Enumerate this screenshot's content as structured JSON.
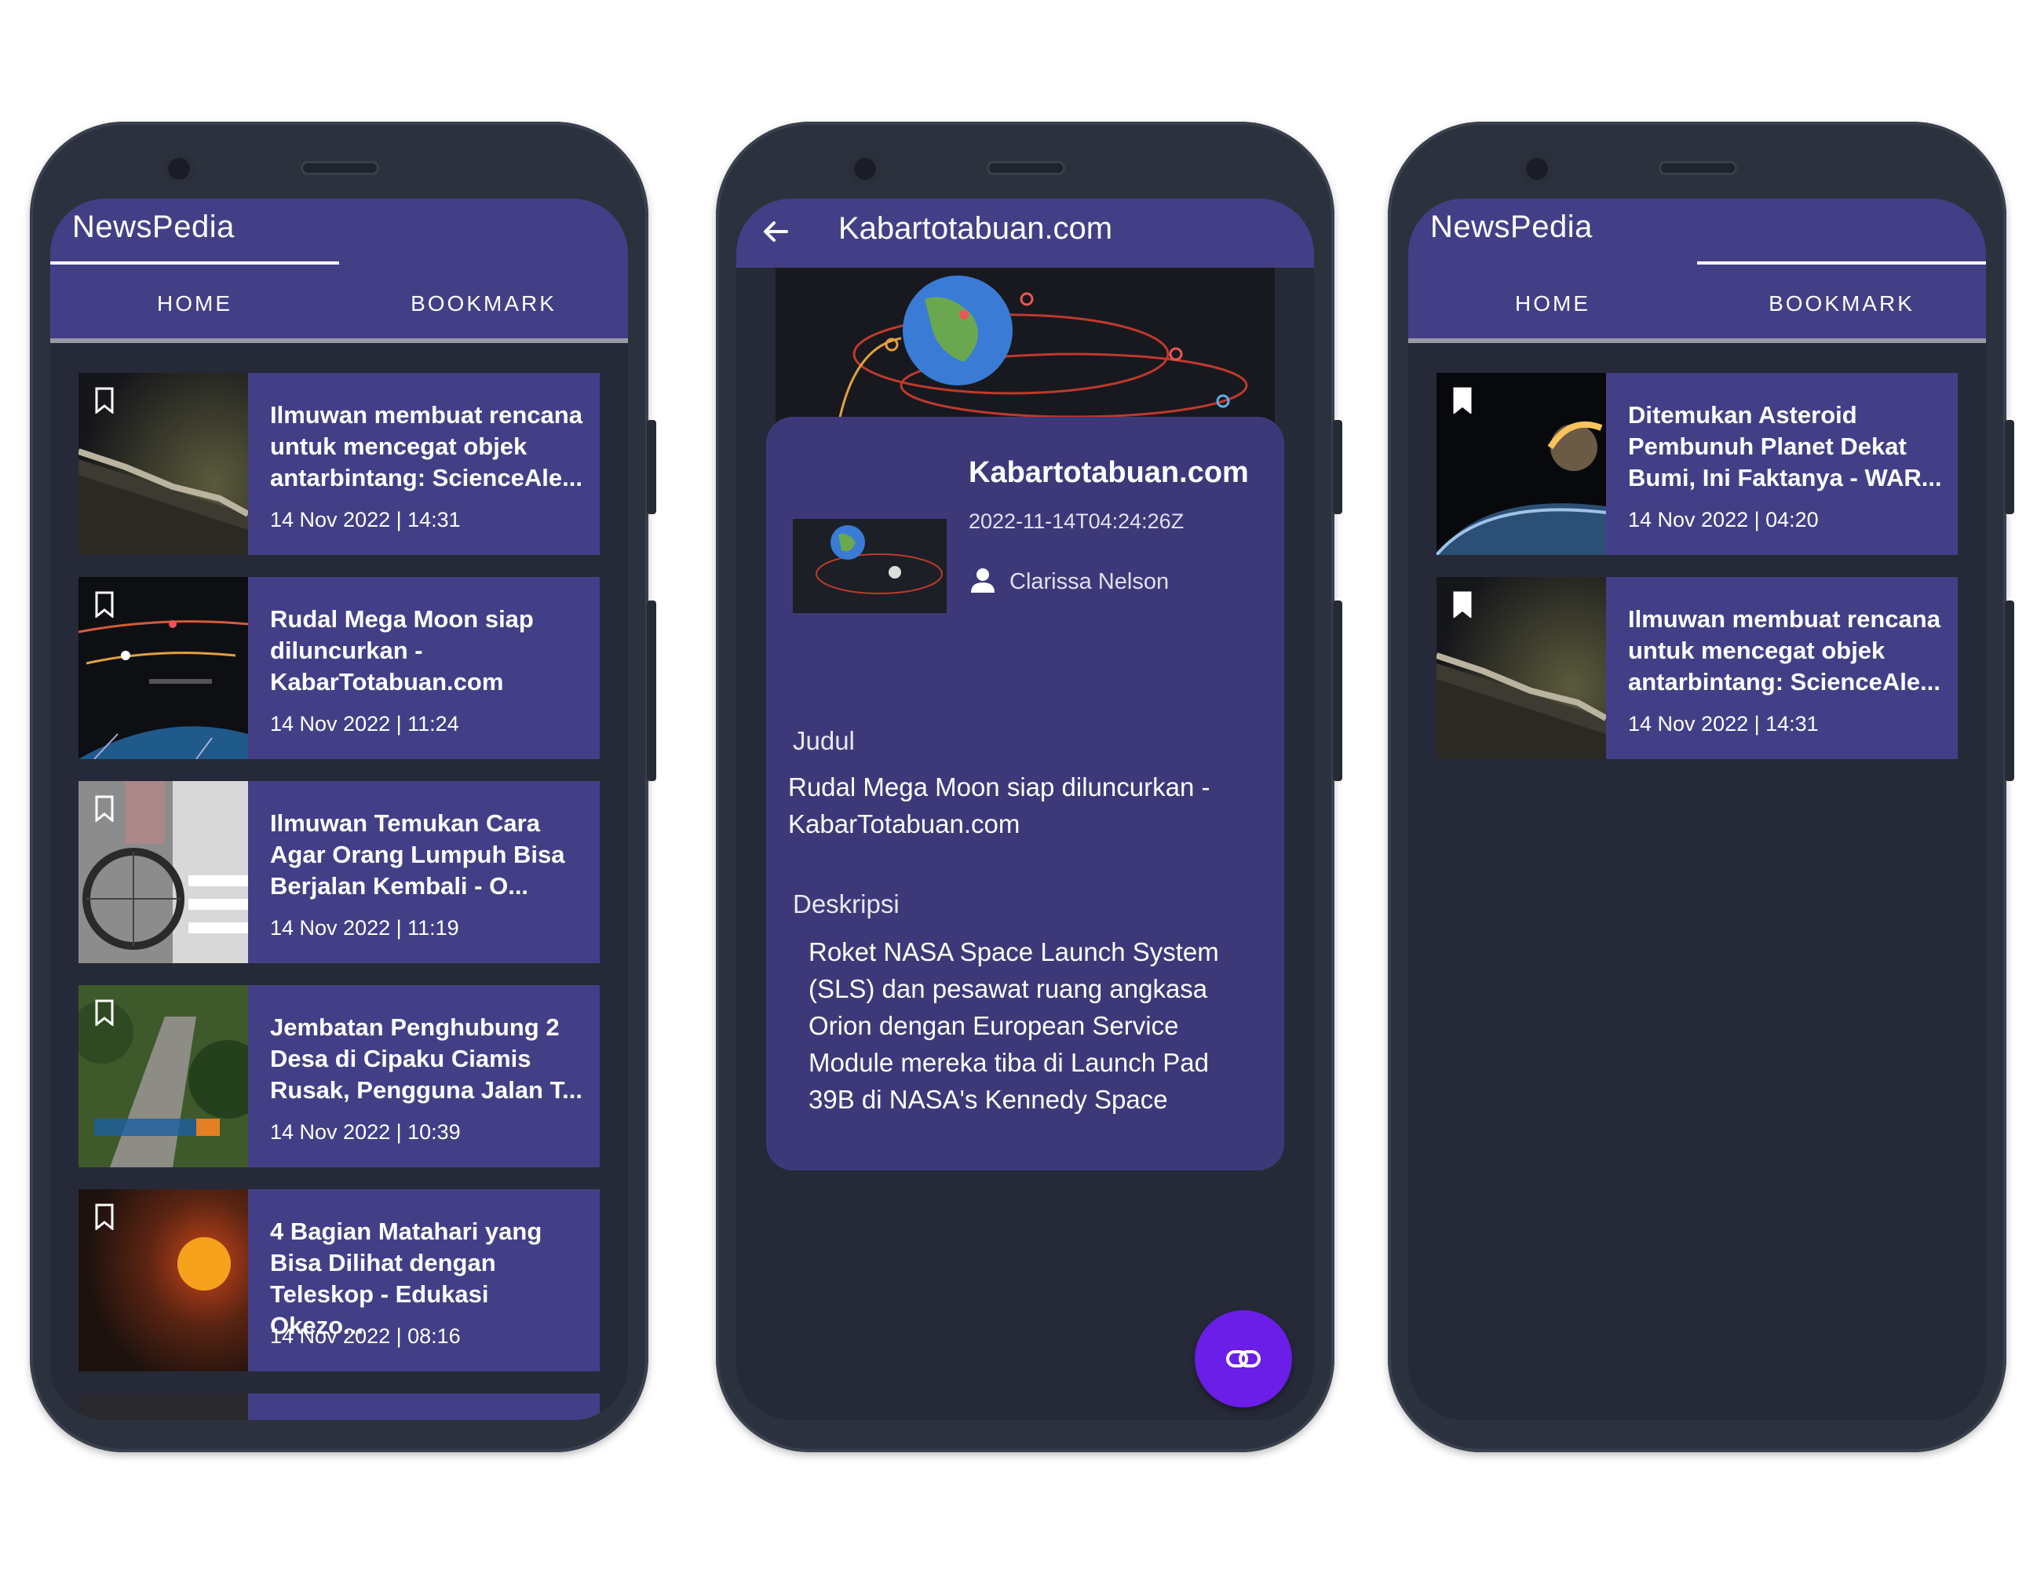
{
  "phone1": {
    "app_title": "NewsPedia",
    "tabs": [
      {
        "label": "HOME",
        "active": true
      },
      {
        "label": "BOOKMARK",
        "active": false
      }
    ],
    "articles": [
      {
        "title": "Ilmuwan membuat rencana untuk mencegat objek antarbintang: ScienceAle...",
        "date": "14 Nov 2022 | 14:31",
        "bookmark_icon": "bookmark-outline-icon"
      },
      {
        "title": "Rudal Mega Moon siap diluncurkan - KabarTotabuan.com",
        "date": "14 Nov 2022 | 11:24",
        "bookmark_icon": "bookmark-outline-icon"
      },
      {
        "title": "Ilmuwan Temukan Cara Agar Orang Lumpuh Bisa Berjalan Kembali - O...",
        "date": "14 Nov 2022 | 11:19",
        "bookmark_icon": "bookmark-outline-icon"
      },
      {
        "title": "Jembatan Penghubung 2 Desa di Cipaku Ciamis Rusak, Pengguna Jalan T...",
        "date": "14 Nov 2022 | 10:39",
        "bookmark_icon": "bookmark-outline-icon"
      },
      {
        "title": "4 Bagian Matahari yang Bisa Dilihat dengan Teleskop - Edukasi Okezo...",
        "date": "14 Nov 2022 | 08:16",
        "bookmark_icon": "bookmark-outline-icon"
      }
    ]
  },
  "phone2": {
    "app_title": "Kabartotabuan.com",
    "back_icon": "arrow-back-icon",
    "source": "Kabartotabuan.com",
    "published": "2022-11-14T04:24:26Z",
    "author": "Clarissa Nelson",
    "judul_label": "Judul",
    "judul_lines": [
      "Rudal Mega Moon siap diluncurkan -",
      "KabarTotabuan.com"
    ],
    "deskripsi_label": "Deskripsi",
    "deskripsi_lines": [
      "Roket NASA Space Launch System",
      "(SLS) dan pesawat ruang angkasa",
      "Orion dengan European Service",
      "Module mereka tiba di Launch Pad",
      "39B di NASA's Kennedy Space"
    ],
    "fab_icon": "link-icon"
  },
  "phone3": {
    "app_title": "NewsPedia",
    "tabs": [
      {
        "label": "HOME",
        "active": false
      },
      {
        "label": "BOOKMARK",
        "active": true
      }
    ],
    "articles": [
      {
        "title": "Ditemukan Asteroid Pembunuh Planet Dekat Bumi, Ini Faktanya - WAR...",
        "date": "14 Nov 2022 | 04:20",
        "bookmark_icon": "bookmark-filled-icon"
      },
      {
        "title": "Ilmuwan membuat rencana untuk mencegat objek antarbintang: ScienceAle...",
        "date": "14 Nov 2022 | 14:31",
        "bookmark_icon": "bookmark-filled-icon"
      }
    ]
  },
  "colors": {
    "appbar": "#433f86",
    "card": "#433f86",
    "screen": "#262a38",
    "fab": "#6a1ee8"
  }
}
